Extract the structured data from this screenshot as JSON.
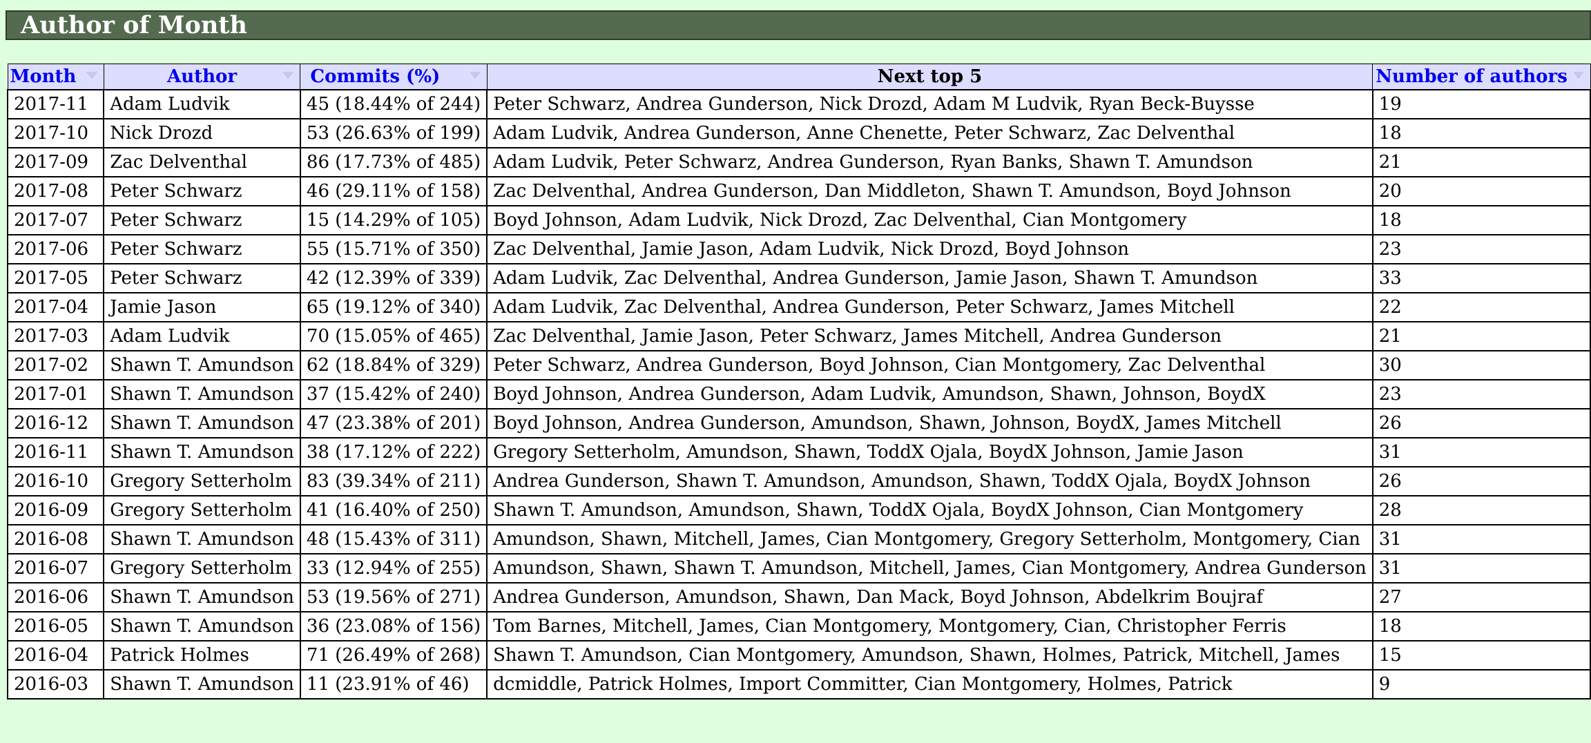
{
  "page": {
    "title": "Author of Month"
  },
  "table": {
    "headers": {
      "month": "Month",
      "author": "Author",
      "commits": "Commits (%)",
      "next_top": "Next top 5",
      "num_authors": "Number of authors"
    },
    "rows": [
      {
        "month": "2017-11",
        "author": "Adam Ludvik",
        "commits": "45 (18.44% of 244)",
        "next": "Peter Schwarz, Andrea Gunderson, Nick Drozd, Adam M Ludvik, Ryan Beck-Buysse",
        "num": "19"
      },
      {
        "month": "2017-10",
        "author": "Nick Drozd",
        "commits": "53 (26.63% of 199)",
        "next": "Adam Ludvik, Andrea Gunderson, Anne Chenette, Peter Schwarz, Zac Delventhal",
        "num": "18"
      },
      {
        "month": "2017-09",
        "author": "Zac Delventhal",
        "commits": "86 (17.73% of 485)",
        "next": "Adam Ludvik, Peter Schwarz, Andrea Gunderson, Ryan Banks, Shawn T. Amundson",
        "num": "21"
      },
      {
        "month": "2017-08",
        "author": "Peter Schwarz",
        "commits": "46 (29.11% of 158)",
        "next": "Zac Delventhal, Andrea Gunderson, Dan Middleton, Shawn T. Amundson, Boyd Johnson",
        "num": "20"
      },
      {
        "month": "2017-07",
        "author": "Peter Schwarz",
        "commits": "15 (14.29% of 105)",
        "next": "Boyd Johnson, Adam Ludvik, Nick Drozd, Zac Delventhal, Cian Montgomery",
        "num": "18"
      },
      {
        "month": "2017-06",
        "author": "Peter Schwarz",
        "commits": "55 (15.71% of 350)",
        "next": "Zac Delventhal, Jamie Jason, Adam Ludvik, Nick Drozd, Boyd Johnson",
        "num": "23"
      },
      {
        "month": "2017-05",
        "author": "Peter Schwarz",
        "commits": "42 (12.39% of 339)",
        "next": "Adam Ludvik, Zac Delventhal, Andrea Gunderson, Jamie Jason, Shawn T. Amundson",
        "num": "33"
      },
      {
        "month": "2017-04",
        "author": "Jamie Jason",
        "commits": "65 (19.12% of 340)",
        "next": "Adam Ludvik, Zac Delventhal, Andrea Gunderson, Peter Schwarz, James Mitchell",
        "num": "22"
      },
      {
        "month": "2017-03",
        "author": "Adam Ludvik",
        "commits": "70 (15.05% of 465)",
        "next": "Zac Delventhal, Jamie Jason, Peter Schwarz, James Mitchell, Andrea Gunderson",
        "num": "21"
      },
      {
        "month": "2017-02",
        "author": "Shawn T. Amundson",
        "commits": "62 (18.84% of 329)",
        "next": "Peter Schwarz, Andrea Gunderson, Boyd Johnson, Cian Montgomery, Zac Delventhal",
        "num": "30"
      },
      {
        "month": "2017-01",
        "author": "Shawn T. Amundson",
        "commits": "37 (15.42% of 240)",
        "next": "Boyd Johnson, Andrea Gunderson, Adam Ludvik, Amundson, Shawn, Johnson, BoydX",
        "num": "23"
      },
      {
        "month": "2016-12",
        "author": "Shawn T. Amundson",
        "commits": "47 (23.38% of 201)",
        "next": "Boyd Johnson, Andrea Gunderson, Amundson, Shawn, Johnson, BoydX, James Mitchell",
        "num": "26"
      },
      {
        "month": "2016-11",
        "author": "Shawn T. Amundson",
        "commits": "38 (17.12% of 222)",
        "next": "Gregory Setterholm, Amundson, Shawn, ToddX Ojala, BoydX Johnson, Jamie Jason",
        "num": "31"
      },
      {
        "month": "2016-10",
        "author": "Gregory Setterholm",
        "commits": "83 (39.34% of 211)",
        "next": "Andrea Gunderson, Shawn T. Amundson, Amundson, Shawn, ToddX Ojala, BoydX Johnson",
        "num": "26"
      },
      {
        "month": "2016-09",
        "author": "Gregory Setterholm",
        "commits": "41 (16.40% of 250)",
        "next": "Shawn T. Amundson, Amundson, Shawn, ToddX Ojala, BoydX Johnson, Cian Montgomery",
        "num": "28"
      },
      {
        "month": "2016-08",
        "author": "Shawn T. Amundson",
        "commits": "48 (15.43% of 311)",
        "next": "Amundson, Shawn, Mitchell, James, Cian Montgomery, Gregory Setterholm, Montgomery, Cian",
        "num": "31"
      },
      {
        "month": "2016-07",
        "author": "Gregory Setterholm",
        "commits": "33 (12.94% of 255)",
        "next": "Amundson, Shawn, Shawn T. Amundson, Mitchell, James, Cian Montgomery, Andrea Gunderson",
        "num": "31"
      },
      {
        "month": "2016-06",
        "author": "Shawn T. Amundson",
        "commits": "53 (19.56% of 271)",
        "next": "Andrea Gunderson, Amundson, Shawn, Dan Mack, Boyd Johnson, Abdelkrim Boujraf",
        "num": "27"
      },
      {
        "month": "2016-05",
        "author": "Shawn T. Amundson",
        "commits": "36 (23.08% of 156)",
        "next": "Tom Barnes, Mitchell, James, Cian Montgomery, Montgomery, Cian, Christopher Ferris",
        "num": "18"
      },
      {
        "month": "2016-04",
        "author": "Patrick Holmes",
        "commits": "71 (26.49% of 268)",
        "next": "Shawn T. Amundson, Cian Montgomery, Amundson, Shawn, Holmes, Patrick, Mitchell, James",
        "num": "15"
      },
      {
        "month": "2016-03",
        "author": "Shawn T. Amundson",
        "commits": "11 (23.91% of 46)",
        "next": "dcmiddle, Patrick Holmes, Import Committer, Cian Montgomery, Holmes, Patrick",
        "num": "9"
      }
    ]
  },
  "icons": {
    "sort": "sort-arrow-icon"
  },
  "colors": {
    "page_background": "#ddffdd",
    "title_background": "#556b4f",
    "title_text": "#ffffff",
    "header_background": "#ddddff",
    "header_link": "#0000ee"
  }
}
